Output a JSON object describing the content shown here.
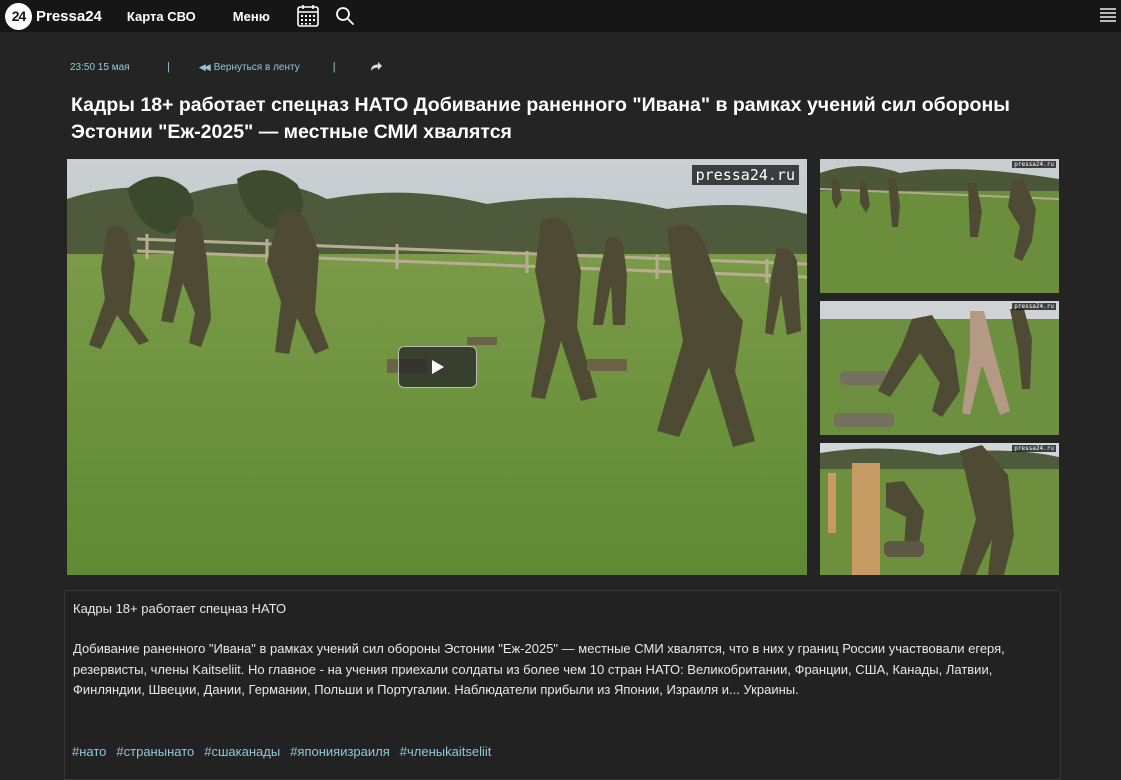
{
  "header": {
    "logo_mark": "24",
    "logo_text": "Pressa24",
    "nav": {
      "svo_label": "Карта СВО",
      "menu_label": "Меню"
    },
    "icons": [
      "calendar-icon",
      "search-icon",
      "hamburger-menu-icon"
    ]
  },
  "meta": {
    "datetime": "23:50 15 мая",
    "separator": "|",
    "back_label": "Вернуться в ленту",
    "share_icon": "share-arrow-icon"
  },
  "article": {
    "title": "Кадры 18+ работает спецназ НАТО Добивание раненного \"Ивана\" в рамках учений сил обороны Эстонии \"Еж-2025\" — местные СМИ хвалятся",
    "watermark": "pressa24.ru",
    "lead": "Кадры 18+ работает спецназ НАТО",
    "body": "Добивание раненного \"Ивана\" в рамках учений сил обороны Эстонии \"Еж-2025\" — местные СМИ хвалятся, что в них у границ России участвовали егеря, резервисты, члены Kaitseliit. Но главное - на учения приехали солдаты из более чем 10 стран НАТО: Великобритании, Франции, США, Канады, Латвии, Финляндии, Швеции, Дании, Германии, Польши и Португалии. Наблюдатели прибыли из Японии, Израиля и... Украины.",
    "tags": [
      "#нато",
      "#странынато",
      "#сшаканады",
      "#японияизраиля",
      "#членыkaitseliit"
    ]
  },
  "colors": {
    "topbar_bg": "#161616",
    "page_bg": "#242424",
    "accent": "#8fc9d9",
    "uniform": "#4e4a33",
    "grass": "#6a8e3e"
  }
}
